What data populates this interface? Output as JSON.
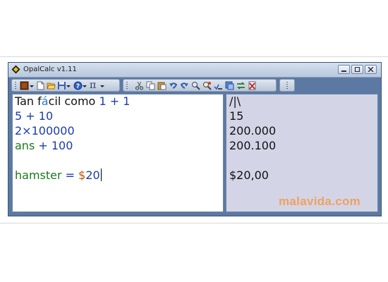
{
  "window": {
    "title": "OpalCalc v1.11"
  },
  "editor": {
    "lines": [
      {
        "parts": [
          "Tan f",
          "á",
          "cil como ",
          "1 + 1"
        ]
      },
      {
        "parts": [
          "5 + 10"
        ]
      },
      {
        "parts": [
          "2×100000"
        ]
      },
      {
        "parts": [
          "ans",
          " + ",
          "100"
        ]
      },
      {
        "parts": []
      },
      {
        "parts": [
          "hamster",
          " = ",
          "$",
          "20"
        ]
      }
    ]
  },
  "results": {
    "lines": [
      "/|\\",
      "15",
      "200.000",
      "200.100",
      "",
      "$20,00"
    ]
  },
  "toolbar": {
    "pi_label": "π"
  },
  "watermark": "malavida.com",
  "colors": {
    "text": "#111111",
    "number": "#1b3db0",
    "variable": "#1b7a1b",
    "currency": "#c8500a",
    "results_bg": "#d3d5e6",
    "window_frame": "#5b79a3"
  }
}
